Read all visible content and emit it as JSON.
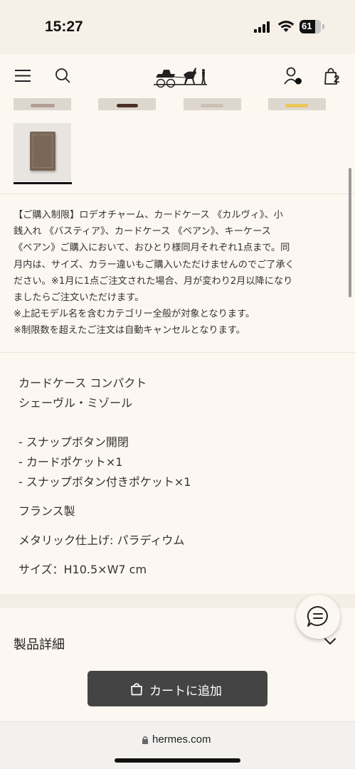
{
  "status_bar": {
    "time": "15:27",
    "battery": "61"
  },
  "header": {
    "cart_count": "2"
  },
  "notice": {
    "lines": [
      "【ご購入制限】ロデオチャーム、カードケース 《カルヴィ》、小",
      "銭入れ 《バスティア》、カードケース 《ベアン》、キーケース",
      "《ベアン》ご購入において、おひとり様同月それぞれ1点まで。同",
      "月内は、サイズ、カラー違いもご購入いただけませんのでご了承く",
      "ださい。※1月に1点ご注文された場合、月が変わり2月以降になり",
      "ましたらご注文いただけます。",
      "※上記モデル名を含むカテゴリー全般が対象となります。",
      "※制限数を超えたご注文は自動キャンセルとなります。"
    ]
  },
  "description": {
    "product_name": "カードケース コンパクト",
    "material": "シェーヴル・ミゾール",
    "features": [
      "- スナップボタン開閉",
      "- カードポケット×1",
      "- スナップボタン付きポケット×1"
    ],
    "origin": "フランス製",
    "finish": "メタリック仕上げ: パラディウム",
    "size": "サイズ：H10.5×W7 cm"
  },
  "details_section": {
    "title": "製品詳細"
  },
  "cart_button": {
    "label": "カートに追加"
  },
  "browser": {
    "url": "hermes.com"
  },
  "icons": {
    "menu": "hamburger-menu-icon",
    "search": "search-icon",
    "account": "account-icon",
    "bag": "shopping-bag-icon",
    "chat": "chat-icon",
    "chevron": "chevron-down-icon",
    "lock": "lock-icon"
  },
  "colors": {
    "background": "#fcf7f1",
    "button": "#444444",
    "text": "#333333",
    "thumb_accent_yellow": "#e9c85a"
  }
}
